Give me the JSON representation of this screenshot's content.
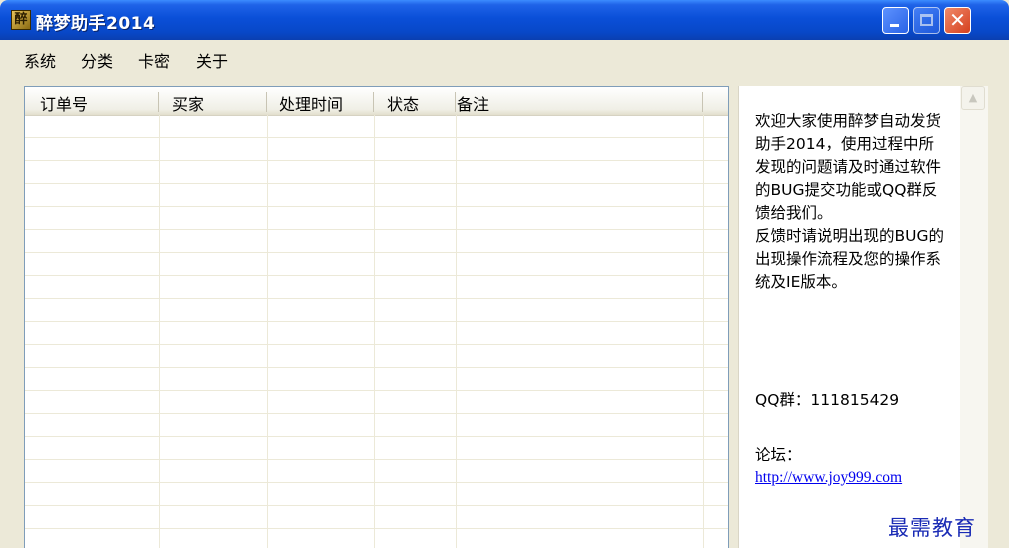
{
  "window": {
    "title": "醉梦助手2014",
    "icon": "app-logo-icon",
    "icon_glyph": "醉",
    "buttons": {
      "minimize": "minimize-icon",
      "maximize": "maximize-icon",
      "close": "close-icon",
      "close_glyph": "✕"
    }
  },
  "menu": {
    "items": [
      {
        "label": "系统"
      },
      {
        "label": "分类"
      },
      {
        "label": "卡密"
      },
      {
        "label": "关于"
      }
    ]
  },
  "orders": {
    "columns": [
      "订单号",
      "买家",
      "处理时间",
      "状态",
      "备注"
    ],
    "rows": []
  },
  "info": {
    "message": "欢迎大家使用醉梦自动发货助手2014，使用过程中所发现的问题请及时通过软件的BUG提交功能或QQ群反馈给我们。\n反馈时请说明出现的BUG的出现操作流程及您的操作系统及IE版本。",
    "qq": "QQ群：111815429",
    "forum_label": "论坛：",
    "forum_url": "http://www.joy999.com",
    "scroll_up_glyph": "▲"
  },
  "watermark": "最需教育",
  "colors": {
    "titlebar": "#0a4fd8",
    "window_bg": "#ece9d8",
    "link": "#0000ee",
    "close_button": "#d5401e"
  }
}
